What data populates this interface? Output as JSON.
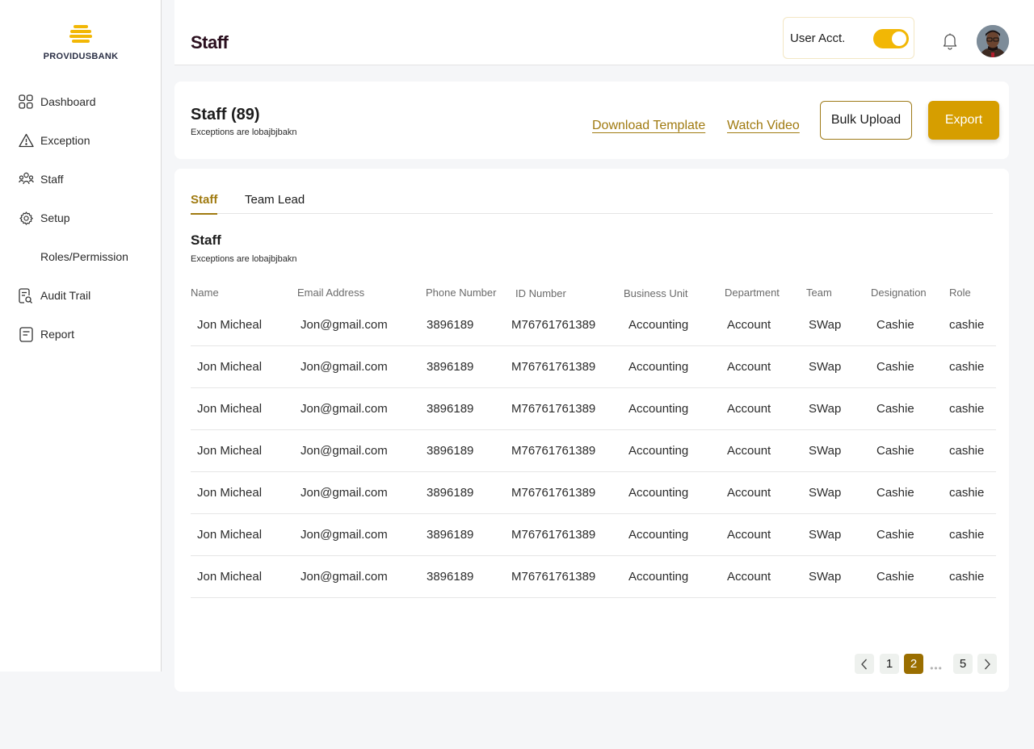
{
  "brand": {
    "name": "PROVIDUSBANK",
    "logo_icon": "providus-logo-icon",
    "accent": "#f2b705"
  },
  "sidebar": {
    "items": [
      {
        "label": "Dashboard",
        "icon": "grid-icon"
      },
      {
        "label": "Exception",
        "icon": "warning-icon"
      },
      {
        "label": "Staff",
        "icon": "people-icon"
      },
      {
        "label": "Setup",
        "icon": "gear-icon"
      },
      {
        "label": "Roles/Permission",
        "icon": ""
      },
      {
        "label": "Audit Trail",
        "icon": "audit-icon"
      },
      {
        "label": "Report",
        "icon": "report-icon"
      }
    ]
  },
  "header": {
    "title": "Staff",
    "user_acct_label": "User Acct.",
    "toggle_on": true
  },
  "summary": {
    "title": "Staff (89)",
    "subtitle": "Exceptions are lobajbjbakn",
    "download_template": "Download Template",
    "watch_video": "Watch Video",
    "bulk_upload": "Bulk Upload",
    "export": "Export"
  },
  "tabs": [
    {
      "label": "Staff",
      "active": true
    },
    {
      "label": "Team Lead",
      "active": false
    }
  ],
  "section": {
    "title": "Staff",
    "subtitle": "Exceptions are lobajbjbakn"
  },
  "table": {
    "columns": [
      "Name",
      "Email Address",
      "Phone Number",
      "ID Number",
      "Business Unit",
      "Department",
      "Team",
      "Designation",
      "Role"
    ],
    "rows": [
      [
        "Jon Micheal",
        "Jon@gmail.com",
        "3896189",
        "M76761761389",
        "Accounting",
        "Account",
        "SWap",
        "Cashie",
        "cashie"
      ],
      [
        "Jon Micheal",
        "Jon@gmail.com",
        "3896189",
        "M76761761389",
        "Accounting",
        "Account",
        "SWap",
        "Cashie",
        "cashie"
      ],
      [
        "Jon Micheal",
        "Jon@gmail.com",
        "3896189",
        "M76761761389",
        "Accounting",
        "Account",
        "SWap",
        "Cashie",
        "cashie"
      ],
      [
        "Jon Micheal",
        "Jon@gmail.com",
        "3896189",
        "M76761761389",
        "Accounting",
        "Account",
        "SWap",
        "Cashie",
        "cashie"
      ],
      [
        "Jon Micheal",
        "Jon@gmail.com",
        "3896189",
        "M76761761389",
        "Accounting",
        "Account",
        "SWap",
        "Cashie",
        "cashie"
      ],
      [
        "Jon Micheal",
        "Jon@gmail.com",
        "3896189",
        "M76761761389",
        "Accounting",
        "Account",
        "SWap",
        "Cashie",
        "cashie"
      ],
      [
        "Jon Micheal",
        "Jon@gmail.com",
        "3896189",
        "M76761761389",
        "Accounting",
        "Account",
        "SWap",
        "Cashie",
        "cashie"
      ]
    ]
  },
  "pagination": {
    "pages": [
      "1",
      "2",
      "5"
    ],
    "current": "2",
    "ellipsis": "•••"
  }
}
